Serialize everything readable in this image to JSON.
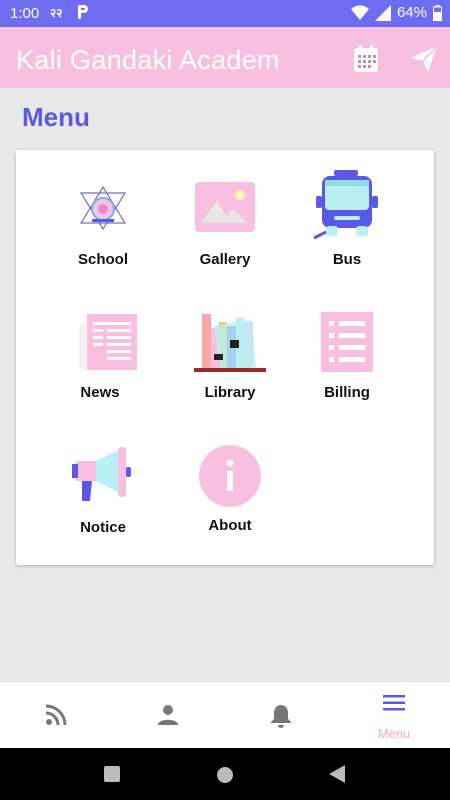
{
  "status_bar": {
    "time": "1:00",
    "battery": "64%"
  },
  "app_bar": {
    "title": "Kali Gandaki Academy"
  },
  "page": {
    "heading": "Menu"
  },
  "menu_items": [
    {
      "label": "School",
      "icon": "school-logo-icon"
    },
    {
      "label": "Gallery",
      "icon": "gallery-icon"
    },
    {
      "label": "Bus",
      "icon": "bus-icon"
    },
    {
      "label": "News",
      "icon": "newspaper-icon"
    },
    {
      "label": "Library",
      "icon": "library-books-icon"
    },
    {
      "label": "Billing",
      "icon": "billing-list-icon"
    },
    {
      "label": "Notice",
      "icon": "megaphone-icon"
    },
    {
      "label": "About",
      "icon": "info-icon"
    }
  ],
  "bottom_nav": [
    {
      "icon": "rss-feed-icon",
      "label": ""
    },
    {
      "icon": "person-icon",
      "label": ""
    },
    {
      "icon": "bell-icon",
      "label": ""
    },
    {
      "icon": "menu-hamburger-icon",
      "label": "Menu",
      "active": true
    }
  ],
  "colors": {
    "status": "#6e6cf0",
    "appbar": "#f9bfe0",
    "accent": "#5a58e6",
    "pink": "#f9bfe0",
    "blue": "#5a58e6",
    "active_nav": "#5a58e6"
  }
}
